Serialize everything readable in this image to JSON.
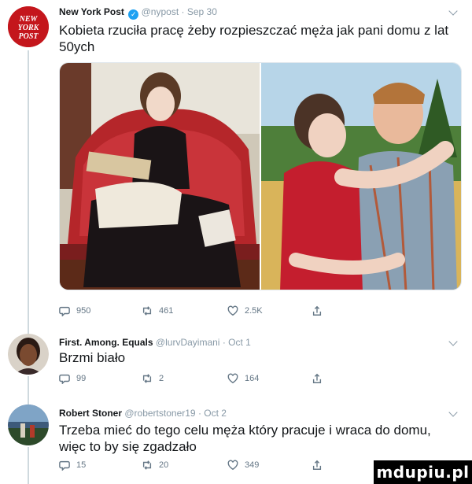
{
  "tweets": [
    {
      "name": "New York Post",
      "handle": "@nypost",
      "date": "Sep 30",
      "text": "Kobieta rzuciła pracę żeby rozpieszczać męża jak pani domu z lat 50ych",
      "avatar_text": "NEW YORK POST",
      "replies": "950",
      "retweets": "461",
      "likes": "2.5K"
    },
    {
      "name": "First. Among. Equals",
      "handle": "@lurvDayimani",
      "date": "Oct 1",
      "text": "Brzmi biało",
      "replies": "99",
      "retweets": "2",
      "likes": "164"
    },
    {
      "name": "Robert Stoner",
      "handle": "@robertstoner19",
      "date": "Oct 2",
      "text": "Trzeba mieć do tego celu męża który pracuje i wraca do domu, więc to by się zgadzało",
      "replies": "15",
      "retweets": "20",
      "likes": "349"
    }
  ],
  "watermark": "mdupiu.pl",
  "colors": {
    "text": "#14171a",
    "meta": "#8899a6",
    "verified": "#1da1f2",
    "nypost_red": "#c4161c"
  },
  "icons": [
    "reply-icon",
    "retweet-icon",
    "like-icon",
    "share-icon",
    "verified-icon",
    "caret-down-icon"
  ]
}
